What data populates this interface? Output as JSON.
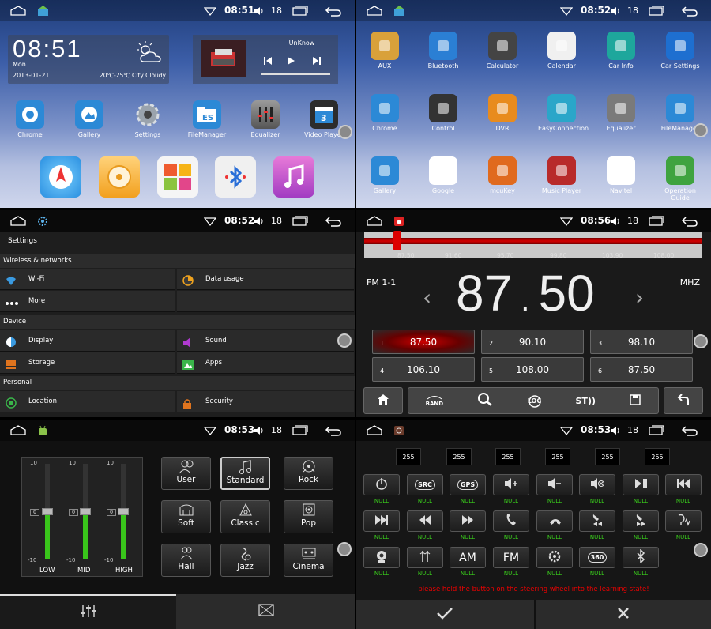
{
  "status_bars": [
    {
      "time": "08:51",
      "volume": "18"
    },
    {
      "time": "08:52",
      "volume": "18"
    },
    {
      "time": "08:52",
      "volume": "18"
    },
    {
      "time": "08:56",
      "volume": "18"
    },
    {
      "time": "08:53",
      "volume": "18"
    },
    {
      "time": "08:53",
      "volume": "18"
    }
  ],
  "home": {
    "clock": {
      "time": "08:51",
      "day": "Mon",
      "date": "2013-01-21",
      "weather": "20℃-25℃ City Cloudy"
    },
    "music": {
      "title": "UnKnow"
    },
    "apps": [
      {
        "label": "Chrome",
        "icon": "chrome-icon"
      },
      {
        "label": "Gallery",
        "icon": "gallery-icon"
      },
      {
        "label": "Settings",
        "icon": "gear-icon"
      },
      {
        "label": "FileManager",
        "icon": "file-manager-icon"
      },
      {
        "label": "Equalizer",
        "icon": "equalizer-icon"
      },
      {
        "label": "Video Player",
        "icon": "video-player-icon"
      }
    ],
    "dock": [
      "navigation-icon",
      "radio-icon",
      "apps-grid-icon",
      "bluetooth-icon",
      "music-icon"
    ]
  },
  "drawer": {
    "apps": [
      {
        "label": "AUX",
        "color": "#d9a13a"
      },
      {
        "label": "Bluetooth",
        "color": "#2b7fd4"
      },
      {
        "label": "Calculator",
        "color": "#444444"
      },
      {
        "label": "Calendar",
        "color": "#f0f0f0"
      },
      {
        "label": "Car Info",
        "color": "#1ea79c"
      },
      {
        "label": "Car Settings",
        "color": "#1e6fd0"
      },
      {
        "label": "Chrome",
        "color": "#2c89d6"
      },
      {
        "label": "Control",
        "color": "#333333"
      },
      {
        "label": "DVR",
        "color": "#e88b1e"
      },
      {
        "label": "EasyConnection",
        "color": "#2aa6c9"
      },
      {
        "label": "Equalizer",
        "color": "#7a7a7a"
      },
      {
        "label": "FileManager",
        "color": "#2c89d6"
      },
      {
        "label": "Gallery",
        "color": "#2c89d6"
      },
      {
        "label": "Google",
        "color": "#ffffff"
      },
      {
        "label": "mcuKey",
        "color": "#e06a1e"
      },
      {
        "label": "Music Player",
        "color": "#b82a2a"
      },
      {
        "label": "Navitel",
        "color": "#ffffff"
      },
      {
        "label": "Operation Guide",
        "color": "#3fa33f"
      }
    ]
  },
  "settings": {
    "title": "Settings",
    "sections": {
      "wireless": "Wireless & networks",
      "device": "Device",
      "personal": "Personal"
    },
    "items": {
      "wifi": "Wi-Fi",
      "data_usage": "Data usage",
      "more": "More",
      "display": "Display",
      "sound": "Sound",
      "storage": "Storage",
      "apps": "Apps",
      "location": "Location",
      "security": "Security"
    }
  },
  "radio": {
    "band": "FM 1-1",
    "unit": "MHZ",
    "freq_int": "87",
    "freq_dec": "50",
    "scale": [
      "87.50",
      "91.60",
      "95.70",
      "99.80",
      "103.90",
      "108.00"
    ],
    "presets": [
      {
        "num": "1",
        "freq": "87.50"
      },
      {
        "num": "2",
        "freq": "90.10"
      },
      {
        "num": "3",
        "freq": "98.10"
      },
      {
        "num": "4",
        "freq": "106.10"
      },
      {
        "num": "5",
        "freq": "108.00"
      },
      {
        "num": "6",
        "freq": "87.50"
      }
    ],
    "buttons": {
      "band": "BAND",
      "loc": "LOC",
      "st": "ST"
    }
  },
  "equalizer": {
    "scale": {
      "top": "10",
      "mid": "0",
      "bottom": "-10"
    },
    "bands": [
      {
        "label": "LOW",
        "value": 0
      },
      {
        "label": "MID",
        "value": 0
      },
      {
        "label": "HIGH",
        "value": 0
      }
    ],
    "presets": [
      "User",
      "Standard",
      "Rock",
      "Soft",
      "Classic",
      "Pop",
      "Hall",
      "Jazz",
      "Cinema"
    ],
    "selected": "Standard"
  },
  "steering": {
    "values": [
      "255",
      "255",
      "255",
      "255",
      "255",
      "255"
    ],
    "null_label": "NULL",
    "text_buttons": {
      "src": "SRC",
      "gps": "GPS",
      "am": "AM",
      "fm": "FM",
      "deg": "360"
    },
    "message": "please hold the button on the steering wheel into the learning state!"
  }
}
